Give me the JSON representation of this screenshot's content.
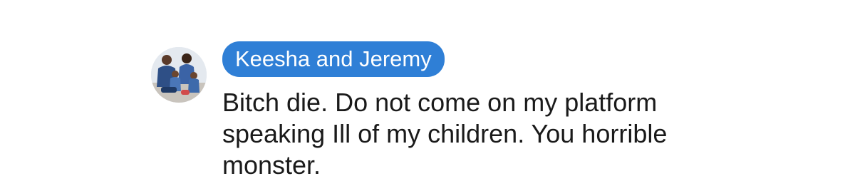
{
  "comment": {
    "author": "Keesha and Jeremy",
    "avatar_icon": "family-photo-avatar",
    "text_lines": [
      "Bitch die. Do not come on my platform",
      "speaking Ill of my children. You horrible",
      "monster."
    ]
  },
  "colors": {
    "name_pill_bg": "#2f7fd6",
    "name_pill_text": "#ffffff",
    "comment_text": "#1a1a1a"
  }
}
